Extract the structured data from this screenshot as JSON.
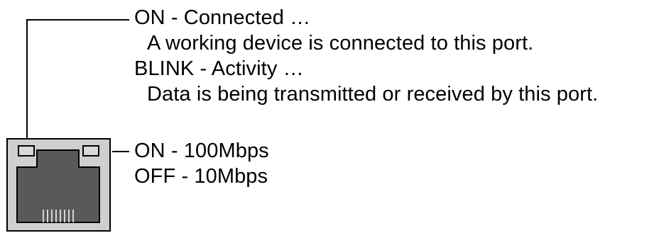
{
  "upper_led": {
    "on_label": "ON  - Connected …",
    "on_detail": "A working device is connected to this port.",
    "blink_label": "BLINK - Activity …",
    "blink_detail": "Data is being transmitted or received by this port."
  },
  "lower_led": {
    "on_label": "ON  - 100Mbps",
    "off_label": "OFF - 10Mbps"
  },
  "colors": {
    "port_body": "#cfcfcf",
    "port_socket": "#595959",
    "led": "#d9d9d9",
    "line": "#000000"
  }
}
